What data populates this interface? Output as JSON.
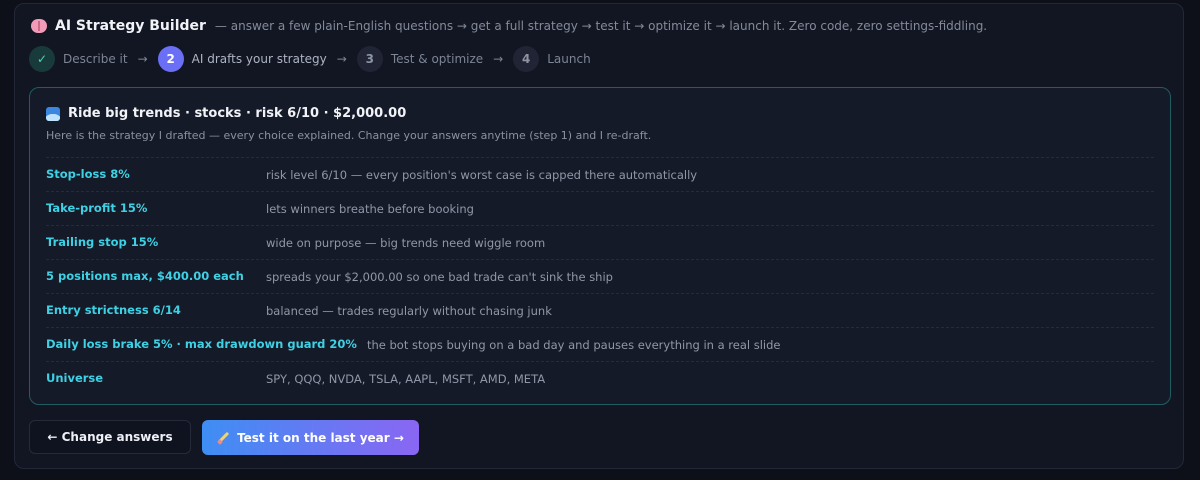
{
  "header": {
    "icon": "brain-icon",
    "title": "AI Strategy Builder",
    "subtitle": "— answer a few plain-English questions → get a full strategy → test it → optimize it → launch it. Zero code, zero settings-fiddling."
  },
  "steps": [
    {
      "badge": "✓",
      "label": "Describe it",
      "state": "done"
    },
    {
      "badge": "2",
      "label": "AI drafts your strategy",
      "state": "active"
    },
    {
      "badge": "3",
      "label": "Test & optimize",
      "state": "todo"
    },
    {
      "badge": "4",
      "label": "Launch",
      "state": "todo"
    }
  ],
  "step_arrow": "→",
  "card": {
    "icon": "wave-icon",
    "title": "Ride big trends · stocks · risk 6/10 · $2,000.00",
    "subtitle": "Here is the strategy I drafted — every choice explained. Change your answers anytime (step 1) and I re-draft.",
    "rows": [
      {
        "key": "Stop-loss 8%",
        "value": "risk level 6/10 — every position's worst case is capped there automatically"
      },
      {
        "key": "Take-profit 15%",
        "value": "lets winners breathe before booking"
      },
      {
        "key": "Trailing stop 15%",
        "value": "wide on purpose — big trends need wiggle room"
      },
      {
        "key": "5 positions max, $400.00 each",
        "value": "spreads your $2,000.00 so one bad trade can't sink the ship"
      },
      {
        "key": "Entry strictness 6/14",
        "value": "balanced — trades regularly without chasing junk"
      },
      {
        "key": "Daily loss brake 5% · max drawdown guard 20%",
        "value": "the bot stops buying on a bad day and pauses everything in a real slide"
      },
      {
        "key": "Universe",
        "value": "SPY, QQQ, NVDA, TSLA, AAPL, MSFT, AMD, META"
      }
    ]
  },
  "actions": {
    "back_label": "← Change answers",
    "test_label": "Test it on the last year →",
    "test_icon": "pencil-icon"
  },
  "colors": {
    "accent_cyan": "#3fd0e4",
    "active_step": "#6a6ff6",
    "done_step": "#49d3bf",
    "primary_gradient_start": "#3e8ef3",
    "primary_gradient_end": "#8a66f3"
  }
}
